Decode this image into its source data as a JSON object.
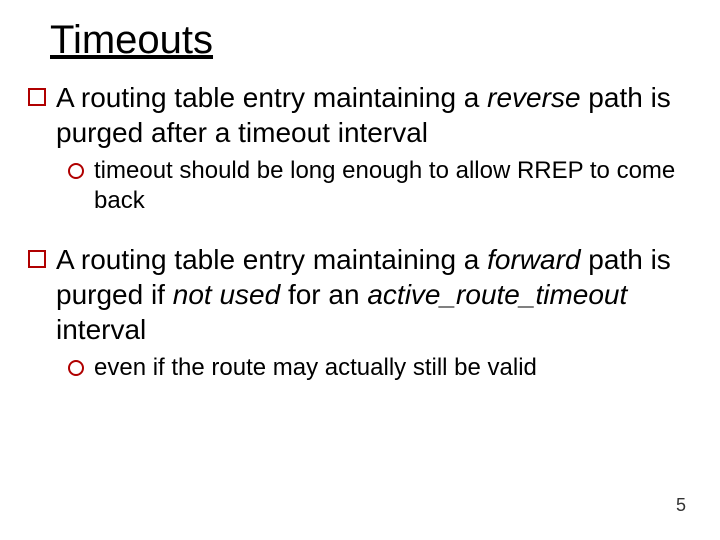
{
  "title": "Timeouts",
  "bullets": [
    {
      "pre": "A routing table entry maintaining a ",
      "emph": "reverse",
      "post": " path is purged after a timeout interval",
      "sub": "timeout should be long enough to allow RREP to come back"
    },
    {
      "pre": "A routing table entry maintaining a ",
      "emph": "forward",
      "post1": " path is purged if ",
      "emph2": "not used",
      "post2": " for an ",
      "emph3": "active_route_timeout",
      "post3": " interval",
      "sub": "even if the route may actually still be valid"
    }
  ],
  "page_number": "5"
}
